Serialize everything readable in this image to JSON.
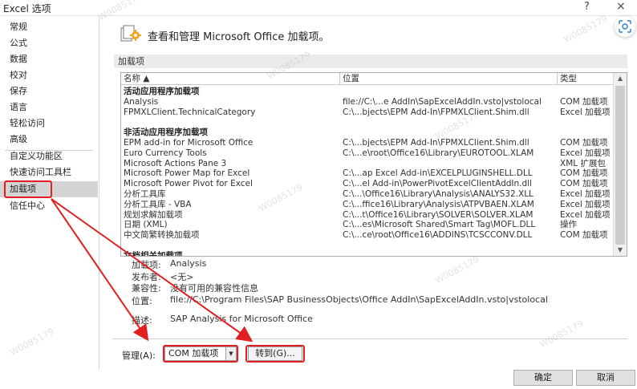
{
  "window": {
    "title": "Excel 选项",
    "help_label": "?",
    "close_label": "×"
  },
  "sidebar": {
    "items": [
      {
        "label": "常规"
      },
      {
        "label": "公式"
      },
      {
        "label": "数据"
      },
      {
        "label": "校对"
      },
      {
        "label": "保存"
      },
      {
        "label": "语言"
      },
      {
        "label": "轻松访问"
      },
      {
        "label": "高级"
      },
      {
        "label": "自定义功能区"
      },
      {
        "label": "快速访问工具栏"
      },
      {
        "label": "加载项",
        "selected": true
      },
      {
        "label": "信任中心"
      }
    ]
  },
  "header": {
    "icon": "addin-gear-icon",
    "title": "查看和管理 Microsoft Office 加载项。"
  },
  "section": {
    "label": "加载项"
  },
  "table": {
    "columns": [
      "名称 ▲",
      "位置",
      "类型"
    ],
    "rows": [
      {
        "group": true,
        "name": "活动应用程序加载项"
      },
      {
        "name": "Analysis",
        "location": "file://C:\\...e AddIn\\SapExcelAddIn.vsto|vstolocal",
        "type": "COM 加载项"
      },
      {
        "name": "FPMXLClient.TechnicalCategory",
        "location": "C:\\...bjects\\EPM Add-In\\FPMXLClient.Shim.dll",
        "type": "Excel 加载项"
      },
      {
        "spacer": true
      },
      {
        "group": true,
        "name": "非活动应用程序加载项"
      },
      {
        "name": "EPM add-in for Microsoft Office",
        "location": "C:\\...bjects\\EPM Add-In\\FPMXLClient.Shim.dll",
        "type": "COM 加载项"
      },
      {
        "name": "Euro Currency Tools",
        "location": "C:\\...e\\root\\Office16\\Library\\EUROTOOL.XLAM",
        "type": "Excel 加载项"
      },
      {
        "name": "Microsoft Actions Pane 3",
        "location": "",
        "type": "XML 扩展包"
      },
      {
        "name": "Microsoft Power Map for Excel",
        "location": "C:\\...ap Excel Add-in\\EXCELPLUGINSHELL.DLL",
        "type": "COM 加载项"
      },
      {
        "name": "Microsoft Power Pivot for Excel",
        "location": "C:\\...el Add-in\\PowerPivotExcelClientAddIn.dll",
        "type": "COM 加载项"
      },
      {
        "name": "分析工具库",
        "location": "C:\\...\\Office16\\Library\\Analysis\\ANALYS32.XLL",
        "type": "Excel 加载项"
      },
      {
        "name": "分析工具库 - VBA",
        "location": "C:\\...ffice16\\Library\\Analysis\\ATPVBAEN.XLAM",
        "type": "Excel 加载项"
      },
      {
        "name": "规划求解加载项",
        "location": "C:\\...t\\Office16\\Library\\SOLVER\\SOLVER.XLAM",
        "type": "Excel 加载项"
      },
      {
        "name": "日期 (XML)",
        "location": "C:\\...es\\Microsoft Shared\\Smart Tag\\MOFL.DLL",
        "type": "操作"
      },
      {
        "name": "中文简繁转换加载项",
        "location": "C:\\...ce\\root\\Office16\\ADDINS\\TCSCCONV.DLL",
        "type": "COM 加载项"
      },
      {
        "spacer": true
      },
      {
        "group": true,
        "name": "文档相关加载项"
      }
    ]
  },
  "details": {
    "addin_label": "加载项:",
    "addin_value": "Analysis",
    "publisher_label": "发布者:",
    "publisher_value": "<无>",
    "compat_label": "兼容性:",
    "compat_value": "没有可用的兼容性信息",
    "location_label": "位置:",
    "location_value": "file://C:\\Program Files\\SAP BusinessObjects\\Office AddIn\\SapExcelAddIn.vsto|vstolocal",
    "desc_label": "描述:",
    "desc_value": "SAP Analysis for Microsoft Office"
  },
  "manage": {
    "label": "管理(A):",
    "selected": "COM 加载项",
    "goto_label": "转到(G)..."
  },
  "footer": {
    "ok_label": "确定",
    "cancel_label": "取消"
  },
  "watermark": {
    "text": "W0085179"
  },
  "colors": {
    "highlight_red": "#e02020",
    "selected_bg": "#d4d4d4",
    "section_bg": "#ebebeb"
  }
}
